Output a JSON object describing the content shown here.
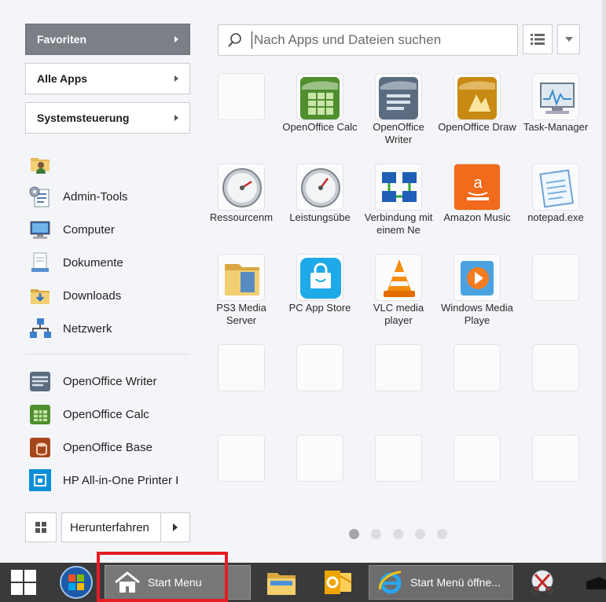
{
  "categories": [
    {
      "label": "Favoriten",
      "active": true
    },
    {
      "label": "Alle Apps",
      "active": false
    },
    {
      "label": "Systemsteuerung",
      "active": false
    }
  ],
  "places": [
    {
      "label": "",
      "icon": "user-folder-icon"
    },
    {
      "label": "Admin-Tools",
      "icon": "admin-tools-icon"
    },
    {
      "label": "Computer",
      "icon": "computer-icon"
    },
    {
      "label": "Dokumente",
      "icon": "documents-icon"
    },
    {
      "label": "Downloads",
      "icon": "downloads-folder-icon"
    },
    {
      "label": "Netzwerk",
      "icon": "network-icon"
    }
  ],
  "recent": [
    {
      "label": "OpenOffice Writer",
      "icon": "openoffice-writer-icon"
    },
    {
      "label": "OpenOffice Calc",
      "icon": "openoffice-calc-icon"
    },
    {
      "label": "OpenOffice Base",
      "icon": "openoffice-base-icon"
    },
    {
      "label": "HP All-in-One Printer I",
      "icon": "hp-printer-icon"
    }
  ],
  "shutdown": {
    "label": "Herunterfahren"
  },
  "search": {
    "placeholder": "Nach Apps und Dateien suchen",
    "value": ""
  },
  "tiles": [
    {
      "label": "",
      "icon": ""
    },
    {
      "label": "OpenOffice Calc",
      "icon": "openoffice-calc-icon"
    },
    {
      "label": "OpenOffice Writer",
      "icon": "openoffice-writer-icon"
    },
    {
      "label": "OpenOffice Draw",
      "icon": "openoffice-draw-icon"
    },
    {
      "label": "Task-Manager",
      "icon": "task-manager-icon"
    },
    {
      "label": "Ressourcenm",
      "icon": "resource-monitor-icon"
    },
    {
      "label": "Leistungsübe",
      "icon": "performance-icon"
    },
    {
      "label": "Verbindung mit einem Ne",
      "icon": "network-connect-icon"
    },
    {
      "label": "Amazon Music",
      "icon": "amazon-music-icon"
    },
    {
      "label": "notepad.exe",
      "icon": "notepad-icon"
    },
    {
      "label": "PS3 Media Server",
      "icon": "ps3-media-server-icon"
    },
    {
      "label": "PC App Store",
      "icon": "pc-app-store-icon"
    },
    {
      "label": "VLC media player",
      "icon": "vlc-icon"
    },
    {
      "label": "Windows Media Playe",
      "icon": "windows-media-player-icon"
    },
    {
      "label": "",
      "icon": ""
    },
    {
      "label": "",
      "icon": ""
    },
    {
      "label": "",
      "icon": ""
    },
    {
      "label": "",
      "icon": ""
    },
    {
      "label": "",
      "icon": ""
    },
    {
      "label": "",
      "icon": ""
    },
    {
      "label": "",
      "icon": ""
    },
    {
      "label": "",
      "icon": ""
    },
    {
      "label": "",
      "icon": ""
    },
    {
      "label": "",
      "icon": ""
    },
    {
      "label": "",
      "icon": ""
    }
  ],
  "pagination": {
    "pages": 5,
    "current": 1
  },
  "taskbar": {
    "start_menu_label": "Start Menu",
    "ie_label": "Start Menü öffne..."
  },
  "colors": {
    "highlight": "#e41d23",
    "taskbar": "#3a3a3a",
    "active_category": "#7b7f86"
  }
}
